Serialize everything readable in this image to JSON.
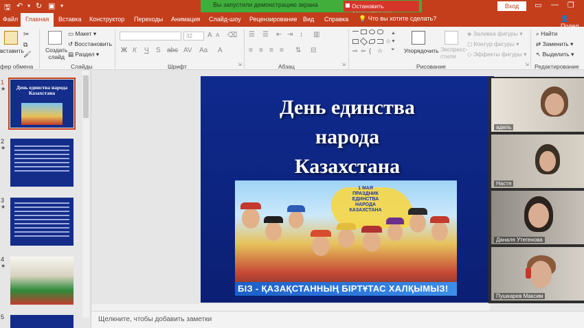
{
  "window": {
    "signin": "Вход",
    "share_banner": "Вы запустили демонстрацию экрана",
    "stop_share": "Остановить демонстрацию"
  },
  "tabs": {
    "file": "Файл",
    "home": "Главная",
    "insert": "Вставка",
    "design": "Конструктор",
    "transitions": "Переходы",
    "animations": "Анимация",
    "slideshow": "Слайд-шоу",
    "review": "Рецензирование",
    "view": "Вид",
    "help": "Справка",
    "tellme": "Что вы хотите сделать?",
    "share": "Подел"
  },
  "ribbon": {
    "paste": "вставить",
    "clipboard": "фер обмена",
    "create_slide": "Создать\nслайд",
    "layout": "Макет",
    "reset": "Восстановить",
    "section": "Раздел",
    "slides_group": "Слайды",
    "font_group": "Шрифт",
    "font_size": "32",
    "paragraph_group": "Абзац",
    "arrange": "Упорядочить",
    "quick_styles": "Экспресс-\nстили",
    "shape_fill": "Заливка фигуры",
    "shape_outline": "Контур фигуры",
    "shape_effects": "Эффекты фигуры",
    "drawing_group": "Рисование",
    "find": "Найти",
    "replace": "Заменить",
    "select": "Выделить",
    "editing_group": "Редактирование"
  },
  "slides": [
    {
      "num": "1",
      "title": "День единства народа Казахстана"
    },
    {
      "num": "2"
    },
    {
      "num": "3"
    },
    {
      "num": "4"
    },
    {
      "num": "5"
    }
  ],
  "slide": {
    "title": "День единства\nнарода\nКазахстана",
    "pic_holiday": "1 МАЯ\nПРАЗДНИК\nЕДИНСТВА\nНАРОДА\nКАЗАХСТАНА",
    "pic_banner": "БІЗ - ҚАЗАҚСТАННЫҢ БІРТҰТАС ХАЛҚЫМЫЗ!"
  },
  "video": [
    {
      "name": "адель"
    },
    {
      "name": "Настя"
    },
    {
      "name": "Даналя Утегенова"
    },
    {
      "name": "Пушкарев Максим"
    }
  ],
  "notes_placeholder": "Щелкните, чтобы добавить заметки"
}
